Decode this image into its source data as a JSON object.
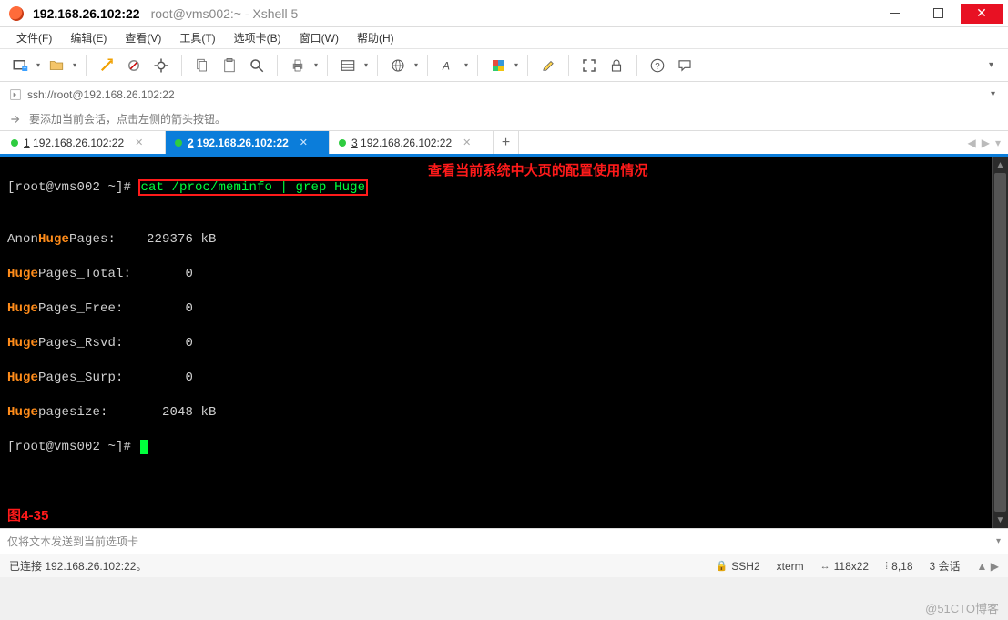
{
  "window": {
    "title_main": "192.168.26.102:22",
    "title_sub": "root@vms002:~ - Xshell 5"
  },
  "menu": {
    "file": "文件(F)",
    "edit": "编辑(E)",
    "view": "查看(V)",
    "tools": "工具(T)",
    "tabs": "选项卡(B)",
    "window": "窗口(W)",
    "help": "帮助(H)"
  },
  "toolbar_icons": [
    "new-session",
    "open",
    "separator",
    "reconnect",
    "disconnect",
    "properties",
    "separator",
    "copy",
    "paste",
    "find",
    "separator",
    "print",
    "separator",
    "encoding",
    "separator",
    "globe",
    "separator",
    "font",
    "separator",
    "color-scheme",
    "separator",
    "highlight",
    "separator",
    "fullscreen",
    "lock",
    "separator",
    "help",
    "chat"
  ],
  "address": {
    "url": "ssh://root@192.168.26.102:22"
  },
  "hint": {
    "text": "要添加当前会话，点击左侧的箭头按钮。"
  },
  "tabs": [
    {
      "num": "1",
      "label": "192.168.26.102:22",
      "active": false
    },
    {
      "num": "2",
      "label": "192.168.26.102:22",
      "active": true
    },
    {
      "num": "3",
      "label": "192.168.26.102:22",
      "active": false
    }
  ],
  "terminal": {
    "prompt": "[root@vms002 ~]# ",
    "command": "cat /proc/meminfo | grep Huge",
    "annotation": "查看当前系统中大页的配置使用情况",
    "lines": [
      {
        "pre": "Anon",
        "hl": "Huge",
        "post": "Pages:    229376 kB"
      },
      {
        "pre": "",
        "hl": "Huge",
        "post": "Pages_Total:       0"
      },
      {
        "pre": "",
        "hl": "Huge",
        "post": "Pages_Free:        0"
      },
      {
        "pre": "",
        "hl": "Huge",
        "post": "Pages_Rsvd:        0"
      },
      {
        "pre": "",
        "hl": "Huge",
        "post": "Pages_Surp:        0"
      },
      {
        "pre": "",
        "hl": "Huge",
        "post": "pagesize:       2048 kB"
      }
    ],
    "fig_label": "图4-35"
  },
  "inputbar": {
    "placeholder": "仅将文本发送到当前选项卡"
  },
  "status": {
    "conn": "已连接 192.168.26.102:22。",
    "proto": "SSH2",
    "term": "xterm",
    "size": "118x22",
    "pos": "8,18",
    "sess": "3 会话"
  },
  "watermark": "@51CTO博客"
}
